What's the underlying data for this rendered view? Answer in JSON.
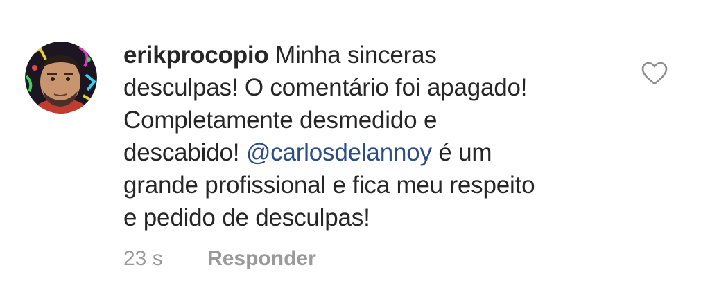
{
  "comment": {
    "username": "erikprocopio",
    "lines": [
      " Minha sinceras",
      "desculpas! O comentário foi apagado!",
      "Completamente desmedido e",
      "descabido! ",
      " é um",
      "grande profissional e fica meu respeito",
      "e pedido de desculpas!"
    ],
    "mention": "@carlosdelannoy",
    "time": "23 s",
    "reply_label": "Responder",
    "like_icon": "heart-outline-icon"
  },
  "colors": {
    "text": "#262626",
    "mention": "#2c4d86",
    "meta": "#9a9a9a",
    "icon": "#8e8e8e"
  }
}
